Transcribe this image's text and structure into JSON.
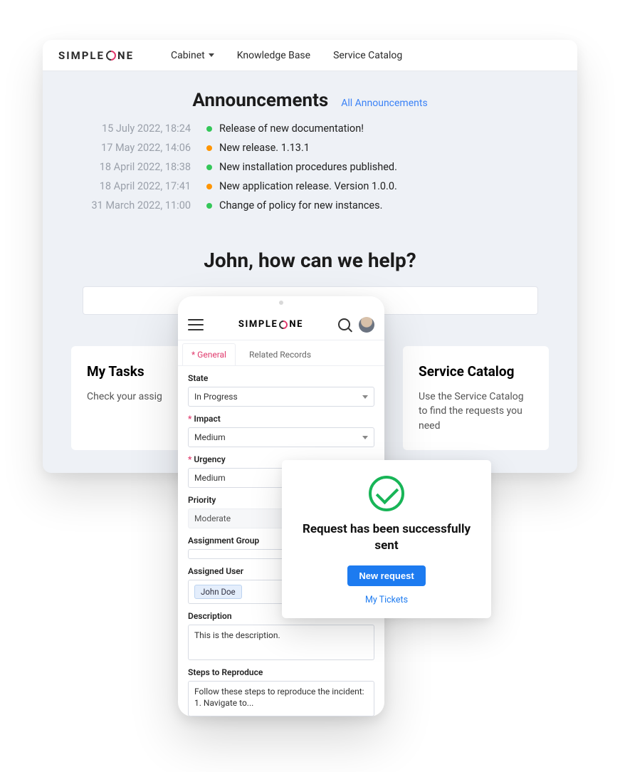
{
  "brand_left": "SIMPLE",
  "brand_right": "NE",
  "nav": {
    "cabinet": "Cabinet",
    "kb": "Knowledge Base",
    "catalog": "Service Catalog"
  },
  "announcements": {
    "title": "Announcements",
    "all_link": "All Announcements",
    "items": [
      {
        "date": "15 July 2022, 18:24",
        "color": "green",
        "text": "Release of new documentation!"
      },
      {
        "date": "17 May 2022, 14:06",
        "color": "orange",
        "text": "New release. 1.13.1"
      },
      {
        "date": "18 April 2022, 18:38",
        "color": "green",
        "text": "New installation procedures published."
      },
      {
        "date": "18 April 2022, 17:41",
        "color": "orange",
        "text": "New application release. Version 1.0.0."
      },
      {
        "date": "31 March 2022, 11:00",
        "color": "green",
        "text": "Change of policy for new instances."
      }
    ]
  },
  "greeting": "John, how can we help?",
  "cards": {
    "tasks": {
      "title": "My Tasks",
      "body": "Check your assig"
    },
    "catalog": {
      "title": "Service Catalog",
      "body": "Use the Service Catalog to find the requests you need"
    }
  },
  "mobile": {
    "tabs": {
      "general": "General",
      "related": "Related Records"
    },
    "fields": {
      "state": {
        "label": "State",
        "value": "In Progress"
      },
      "impact": {
        "label": "Impact",
        "value": "Medium"
      },
      "urgency": {
        "label": "Urgency",
        "value": "Medium"
      },
      "priority": {
        "label": "Priority",
        "value": "Moderate"
      },
      "assign_group": {
        "label": "Assignment Group",
        "value": ""
      },
      "assign_user": {
        "label": "Assigned User",
        "value": "John Doe"
      },
      "description": {
        "label": "Description",
        "value": "This is the description."
      },
      "steps": {
        "label": "Steps to Reproduce",
        "value": "Follow these steps to reproduce the incident:\n1. Navigate to..."
      }
    }
  },
  "toast": {
    "title": "Request has been successfully sent",
    "button": "New request",
    "link": "My Tickets"
  }
}
